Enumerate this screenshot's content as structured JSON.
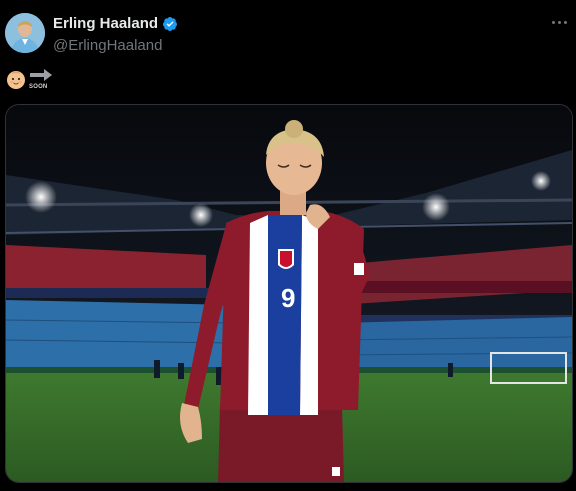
{
  "author": {
    "display_name": "Erling Haaland",
    "handle": "@ErlingHaaland",
    "verified": true,
    "avatar_icon": "avatar-photo"
  },
  "tweet": {
    "emoji_baby": "baby-emoji",
    "emoji_arrow": "soon-arrow-emoji",
    "soon_text": "SOON"
  },
  "media": {
    "alt": "",
    "jersey_number": "9",
    "colors": {
      "jersey_red": "#8e1b2b",
      "stripe_blue": "#1b3f9e",
      "pitch": "#3f7a2f",
      "seats": "#2d6fa8"
    }
  },
  "colors": {
    "background": "#000000",
    "verified": "#1d9bf0",
    "secondary_text": "#71767b"
  }
}
